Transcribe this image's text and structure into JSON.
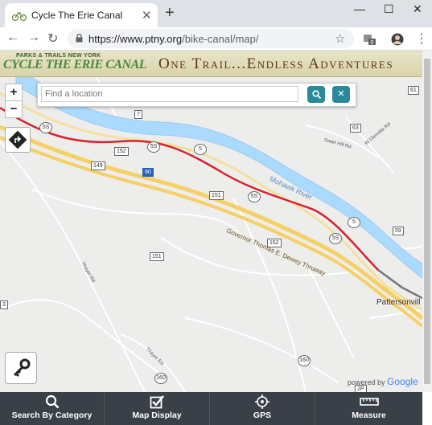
{
  "browser": {
    "tab_title": "Cycle The Erie Canal",
    "url_host": "https://www.ptny.org",
    "url_path": "/bike-canal/map/",
    "ext_badge": "0"
  },
  "banner": {
    "logo_top": "PARKS & TRAILS NEW YORK",
    "logo_main": "CYCLE THE ERIE CANAL",
    "tagline": "One Trail...Endless Adventures"
  },
  "map": {
    "search_placeholder": "Find a location",
    "zoom_in": "+",
    "zoom_out": "−",
    "powered_by": "powered by",
    "google": "Google",
    "labels": {
      "mohawk_river": "Mohawk River",
      "thruway": "Governor Thomas E. Dewey Thruway",
      "pattersonville": "Pattersonvill",
      "swart_hill": "Swart Hill Rd",
      "w_glenville": "W Glenville Rd",
      "thayer_rd_1": "Thayer Rd",
      "thayer_rd_2": "Thayer Rd"
    },
    "shields": [
      "5S",
      "5S",
      "5S",
      "5",
      "5",
      "7",
      "152",
      "149",
      "151",
      "152",
      "151",
      "160",
      "160",
      "63",
      "61",
      "59",
      "2P",
      "90",
      "3"
    ]
  },
  "nav": {
    "items": [
      {
        "label": "Search By Category"
      },
      {
        "label": "Map Display"
      },
      {
        "label": "GPS"
      },
      {
        "label": "Measure"
      }
    ]
  },
  "colors": {
    "river": "#aadaff",
    "trail": "#d8222b",
    "highway": "#f6cf65",
    "nav_bg": "#3a4048",
    "button_teal": "#2a8a9a"
  }
}
